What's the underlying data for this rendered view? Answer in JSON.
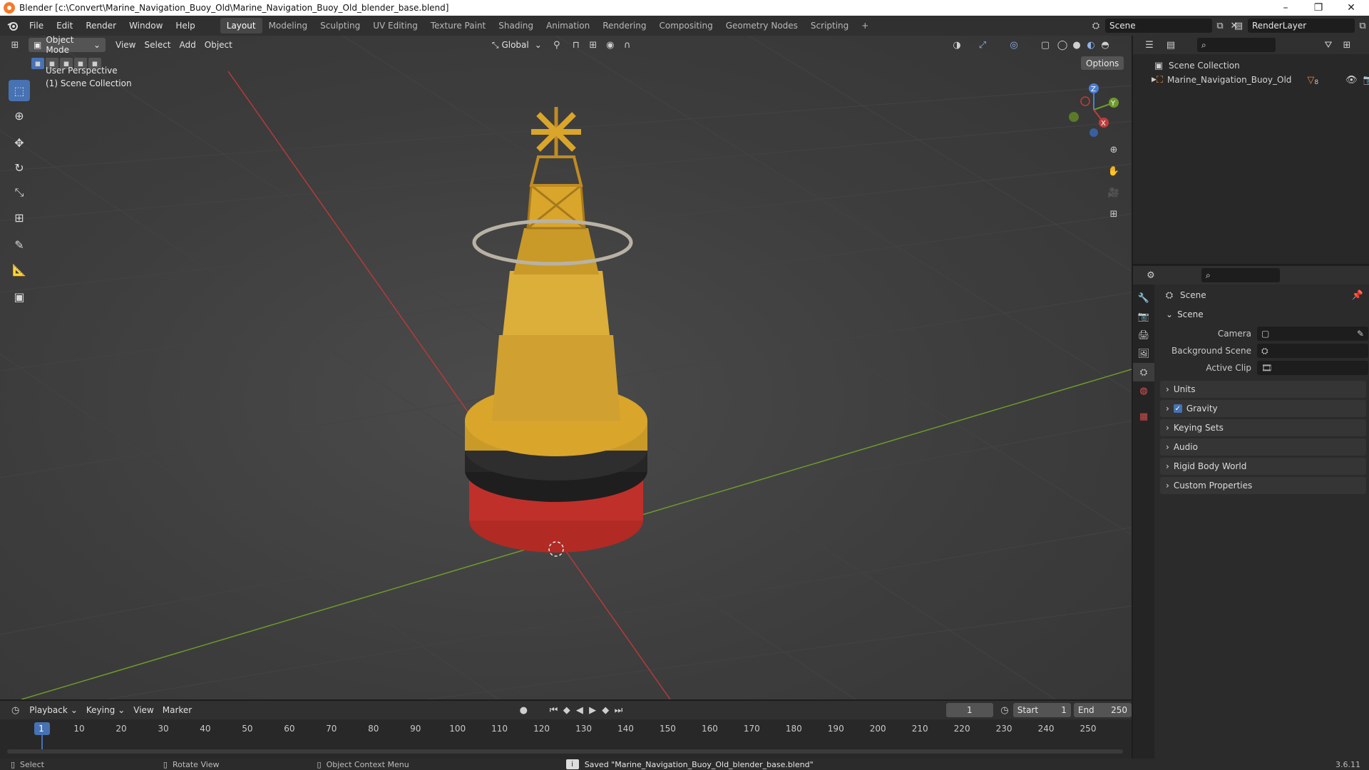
{
  "window": {
    "title": "Blender [c:\\Convert\\Marine_Navigation_Buoy_Old\\Marine_Navigation_Buoy_Old_blender_base.blend]",
    "minimize": "–",
    "maximize": "❐",
    "close": "✕"
  },
  "menu": {
    "items": [
      "File",
      "Edit",
      "Render",
      "Window",
      "Help"
    ]
  },
  "workspaces": {
    "tabs": [
      "Layout",
      "Modeling",
      "Sculpting",
      "UV Editing",
      "Texture Paint",
      "Shading",
      "Animation",
      "Rendering",
      "Compositing",
      "Geometry Nodes",
      "Scripting"
    ],
    "active": "Layout",
    "add": "+"
  },
  "scene_selector": {
    "value": "Scene"
  },
  "layer_selector": {
    "value": "RenderLayer"
  },
  "viewport": {
    "mode": "Object Mode",
    "menus": [
      "View",
      "Select",
      "Add",
      "Object"
    ],
    "orientation": "Global",
    "options": "Options",
    "overlay_line1": "User Perspective",
    "overlay_line2": "(1) Scene Collection",
    "gizmo": {
      "x": "X",
      "y": "Y",
      "z": "Z"
    }
  },
  "outliner": {
    "root": "Scene Collection",
    "items": [
      {
        "label": "Marine_Navigation_Buoy_Old",
        "badge": "8"
      }
    ]
  },
  "properties": {
    "header": "Scene",
    "section": "Scene",
    "fields": [
      {
        "label": "Camera",
        "value": ""
      },
      {
        "label": "Background Scene",
        "value": ""
      },
      {
        "label": "Active Clip",
        "value": ""
      }
    ],
    "panels": [
      "Units",
      "Gravity",
      "Keying Sets",
      "Audio",
      "Rigid Body World",
      "Custom Properties"
    ],
    "gravity_checked": true
  },
  "timeline": {
    "menus": [
      "Playback",
      "Keying",
      "View",
      "Marker"
    ],
    "current_frame": "1",
    "start_label": "Start",
    "start_value": "1",
    "end_label": "End",
    "end_value": "250",
    "ticks": [
      "1",
      "10",
      "20",
      "30",
      "40",
      "50",
      "60",
      "70",
      "80",
      "90",
      "100",
      "110",
      "120",
      "130",
      "140",
      "150",
      "160",
      "170",
      "180",
      "190",
      "200",
      "210",
      "220",
      "230",
      "240",
      "250"
    ]
  },
  "statusbar": {
    "select": "Select",
    "rotate": "Rotate View",
    "context": "Object Context Menu",
    "message": "Saved \"Marine_Navigation_Buoy_Old_blender_base.blend\"",
    "version": "3.6.11"
  },
  "colors": {
    "accent": "#4772b3",
    "axis_x": "#c23b3b",
    "axis_y": "#6e9a2b",
    "buoy_yellow": "#d9a52b",
    "buoy_red": "#c0302a"
  }
}
